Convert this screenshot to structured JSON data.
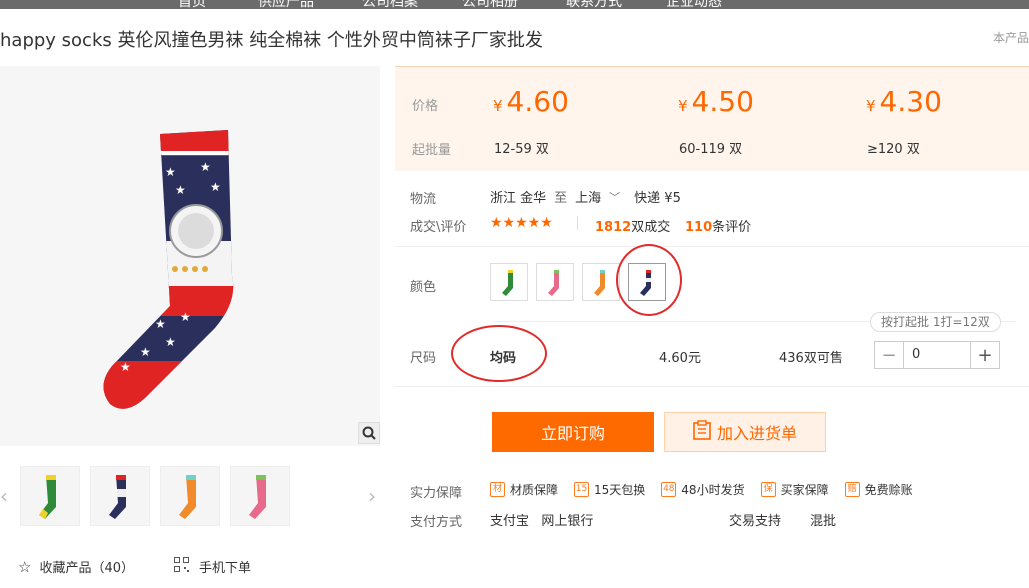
{
  "nav": {
    "items": [
      "首页",
      "供应产品",
      "公司档案",
      "公司相册",
      "联系方式",
      "企业动态"
    ]
  },
  "title": "happy socks 英伦风撞色男袜 纯全棉袜 个性外贸中筒袜子厂家批发",
  "more_link": "本产品",
  "price_label": "价格",
  "qty_label": "起批量",
  "currency": "¥",
  "tiers": [
    {
      "price": "4.60",
      "range": "12-59 双"
    },
    {
      "price": "4.50",
      "range": "60-119 双"
    },
    {
      "price": "4.30",
      "range": "≥120 双"
    }
  ],
  "logistics": {
    "label": "物流",
    "from": "浙江 金华",
    "to_word": "至",
    "to": "上海",
    "express": "快递 ¥5"
  },
  "rating": {
    "label": "成交\\评价",
    "stars": "★★★★★",
    "deals_count": "1812",
    "deals_suffix": "双成交",
    "reviews_count": "110",
    "reviews_suffix": "条评价"
  },
  "color": {
    "label": "颜色"
  },
  "pack_info": "按打起批 1打=12双",
  "size": {
    "label": "尺码",
    "value": "均码",
    "price": "4.60元",
    "stock": "436双可售"
  },
  "stepper": {
    "minus": "−",
    "value": "0",
    "plus": "+"
  },
  "buttons": {
    "buy": "立即订购",
    "cart": "加入进货单"
  },
  "guarantee": {
    "label": "实力保障",
    "items": [
      {
        "icon_text": "材",
        "text": "材质保障"
      },
      {
        "icon_text": "15",
        "text": "15天包换"
      },
      {
        "icon_text": "48",
        "text": "48小时发货"
      },
      {
        "icon_text": "保",
        "text": "买家保障"
      },
      {
        "icon_text": "赔",
        "text": "免费赊账"
      }
    ]
  },
  "payment": {
    "label": "支付方式",
    "methods": "支付宝   网上银行",
    "trade_label": "交易支持",
    "trade_value": "混批"
  },
  "favorites": "收藏产品（40）",
  "mobile_order": "手机下单",
  "colors": {
    "accent": "#ff6700",
    "highlight_circle": "#e12b2b"
  }
}
